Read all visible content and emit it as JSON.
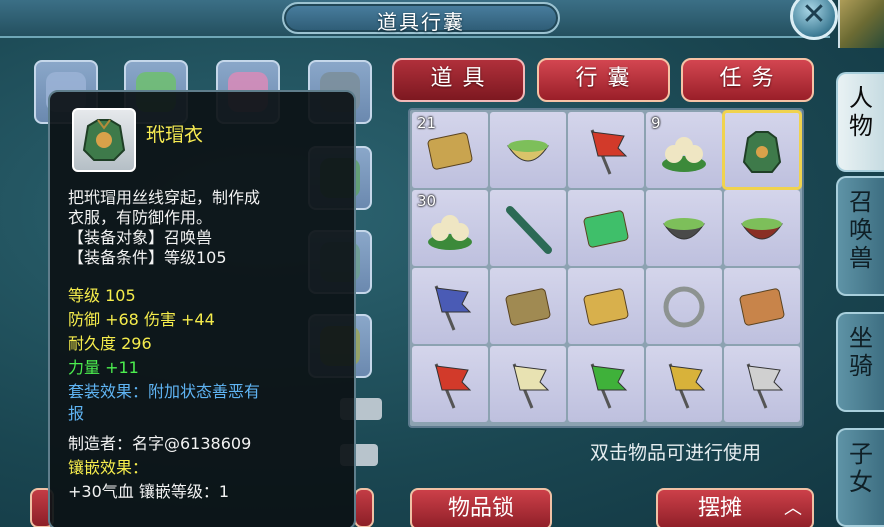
{
  "window": {
    "title": "道具行囊",
    "close_icon": "close-icon"
  },
  "side_tabs": [
    {
      "label": "人\n物",
      "active": true
    },
    {
      "label": "召\n唤\n兽",
      "active": false
    },
    {
      "label": "坐\n骑",
      "active": false
    },
    {
      "label": "子\n女",
      "active": false
    }
  ],
  "tabs": [
    {
      "label": "道具",
      "active": true
    },
    {
      "label": "行囊",
      "active": false
    },
    {
      "label": "任务",
      "active": false
    }
  ],
  "grid": [
    {
      "count": "21",
      "icon": "scroll-icon",
      "color": "#c9a44f"
    },
    {
      "count": "",
      "icon": "bowl-icon",
      "color": "#d9c36a"
    },
    {
      "count": "",
      "icon": "red-flag-icon",
      "color": "#d23a2a"
    },
    {
      "count": "9",
      "icon": "buns-icon",
      "color": "#efe6c3"
    },
    {
      "count": "",
      "icon": "armor-icon",
      "color": "#3e7a4a",
      "selected": true
    },
    {
      "count": "30",
      "icon": "buns-icon",
      "color": "#efe6c3"
    },
    {
      "count": "",
      "icon": "umbrella-icon",
      "color": "#2c6a55"
    },
    {
      "count": "",
      "icon": "leaf-pouch-icon",
      "color": "#3fbf6a"
    },
    {
      "count": "",
      "icon": "herb-pot-icon",
      "color": "#4a4a4a"
    },
    {
      "count": "",
      "icon": "jar-icon",
      "color": "#8a2f25"
    },
    {
      "count": "",
      "icon": "blue-flag-icon",
      "color": "#4a5bb5"
    },
    {
      "count": "",
      "icon": "bracer-icon",
      "color": "#a08a52"
    },
    {
      "count": "",
      "icon": "tablet-icon",
      "color": "#d8b04c"
    },
    {
      "count": "",
      "icon": "ring-icon",
      "color": "#8d9391"
    },
    {
      "count": "",
      "icon": "map-icon",
      "color": "#c8844a"
    },
    {
      "count": "",
      "icon": "red-flag-icon",
      "color": "#d23a2a"
    },
    {
      "count": "",
      "icon": "white-flag-icon",
      "color": "#e8e2b2"
    },
    {
      "count": "",
      "icon": "green-flag-icon",
      "color": "#3fb13a"
    },
    {
      "count": "",
      "icon": "yellow-flag-icon",
      "color": "#d8b23a"
    },
    {
      "count": "",
      "icon": "silver-flag-icon",
      "color": "#d0d0d0"
    }
  ],
  "hint": "双击物品可进行使用",
  "buttons": {
    "lock": "物品锁",
    "stall": "摆摊",
    "stall_icon": "chevron-up-icon"
  },
  "tooltip": {
    "name": "玳瑁衣",
    "desc1": "把玳瑁用丝线穿起，制作成",
    "desc2": "衣服，有防御作用。",
    "target": "【装备对象】召唤兽",
    "cond": "【装备条件】等级105",
    "level": "等级 105",
    "defense": "防御 +68 伤害 +44",
    "durability": "耐久度 296",
    "strength": "力量 +11",
    "set1": "套装效果：附加状态善恶有",
    "set2": "报",
    "maker": "制造者：名字@6138609",
    "inlay_title": "镶嵌效果：",
    "inlay": "+30气血 镶嵌等级：1"
  },
  "colors": {
    "tab_red": "#c33c45",
    "grid_cell": "#c8cae5",
    "tooltip_name": "#f7ec52",
    "stat_green": "#4cef4f",
    "set_blue": "#5fb4f3"
  }
}
